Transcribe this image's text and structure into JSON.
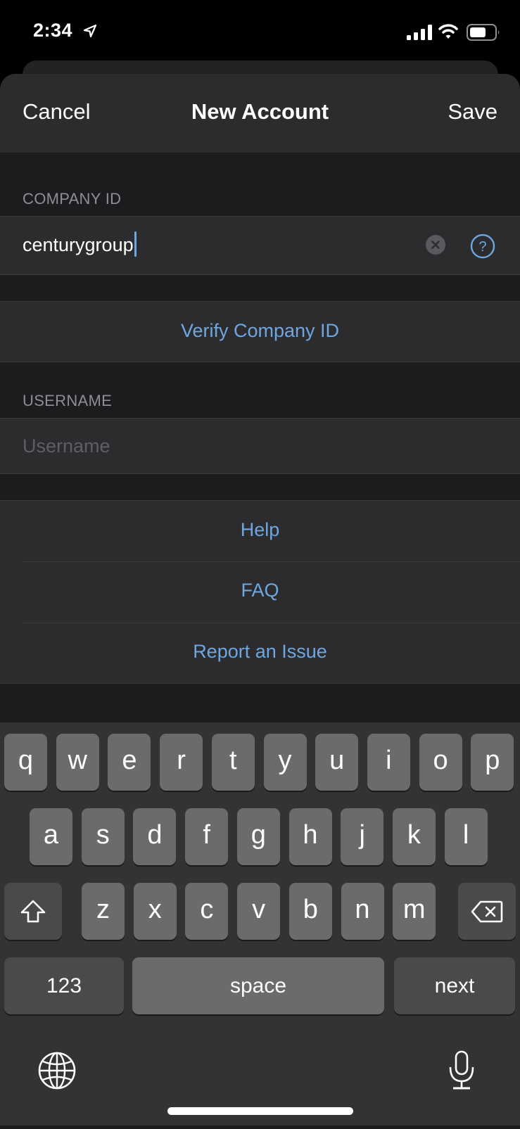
{
  "status_bar": {
    "time": "2:34",
    "icons": [
      "location-arrow-icon",
      "cellular-signal-icon",
      "wifi-icon",
      "battery-icon"
    ]
  },
  "nav": {
    "cancel_label": "Cancel",
    "title": "New Account",
    "save_label": "Save"
  },
  "company_section": {
    "header": "COMPANY ID",
    "value": "centurygroup",
    "clear_icon": "clear-circle-icon",
    "help_icon": "question-circle-icon"
  },
  "verify": {
    "label": "Verify Company ID"
  },
  "username_section": {
    "header": "USERNAME",
    "value": "",
    "placeholder": "Username"
  },
  "support_links": [
    {
      "label": "Help"
    },
    {
      "label": "FAQ"
    },
    {
      "label": "Report an Issue"
    }
  ],
  "keyboard": {
    "row1": [
      "q",
      "w",
      "e",
      "r",
      "t",
      "y",
      "u",
      "i",
      "o",
      "p"
    ],
    "row2": [
      "a",
      "s",
      "d",
      "f",
      "g",
      "h",
      "j",
      "k",
      "l"
    ],
    "row3": [
      "z",
      "x",
      "c",
      "v",
      "b",
      "n",
      "m"
    ],
    "shift_icon": "shift-arrow-icon",
    "delete_icon": "backspace-icon",
    "numbers_label": "123",
    "space_label": "space",
    "return_label": "next",
    "globe_icon": "globe-icon",
    "mic_icon": "microphone-icon"
  },
  "colors": {
    "accent": "#6ea6e0",
    "sheet_bg": "#1c1c1e",
    "cell_bg": "#2c2c2e",
    "key_bg": "#6b6b6d",
    "key_dark_bg": "#4a4a4c",
    "keyboard_bg": "#333334"
  }
}
